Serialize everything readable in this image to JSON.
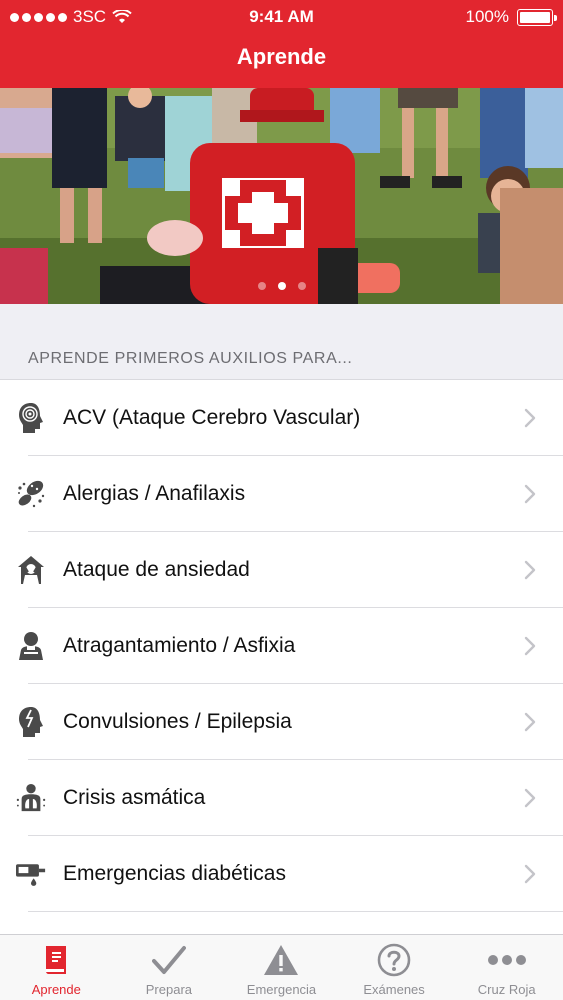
{
  "status_bar": {
    "carrier": "3SC",
    "time": "9:41 AM",
    "battery": "100%"
  },
  "header": {
    "title": "Aprende"
  },
  "hero": {
    "pages": 3,
    "active_page": 2
  },
  "section": {
    "title": "APRENDE PRIMEROS AUXILIOS PARA..."
  },
  "list": {
    "items": [
      {
        "label": "ACV (Ataque Cerebro Vascular)",
        "icon": "brain-head-icon"
      },
      {
        "label": "Alergias / Anafilaxis",
        "icon": "allergy-icon"
      },
      {
        "label": "Ataque de ansiedad",
        "icon": "anxiety-icon"
      },
      {
        "label": "Atragantamiento / Asfixia",
        "icon": "choking-icon"
      },
      {
        "label": "Convulsiones / Epilepsia",
        "icon": "seizure-head-icon"
      },
      {
        "label": "Crisis asmática",
        "icon": "lungs-icon"
      },
      {
        "label": "Emergencias diabéticas",
        "icon": "glucose-meter-icon"
      }
    ]
  },
  "tabbar": {
    "tabs": [
      {
        "label": "Aprende",
        "icon": "book-icon"
      },
      {
        "label": "Prepara",
        "icon": "checkmark-icon"
      },
      {
        "label": "Emergencia",
        "icon": "warning-icon"
      },
      {
        "label": "Exámenes",
        "icon": "question-icon"
      },
      {
        "label": "Cruz Roja",
        "icon": "more-icon"
      }
    ],
    "active": "Aprende"
  },
  "colors": {
    "brand_red": "#e2262f",
    "inactive_gray": "#8e8e93",
    "icon_dark": "#4a4a4a"
  }
}
